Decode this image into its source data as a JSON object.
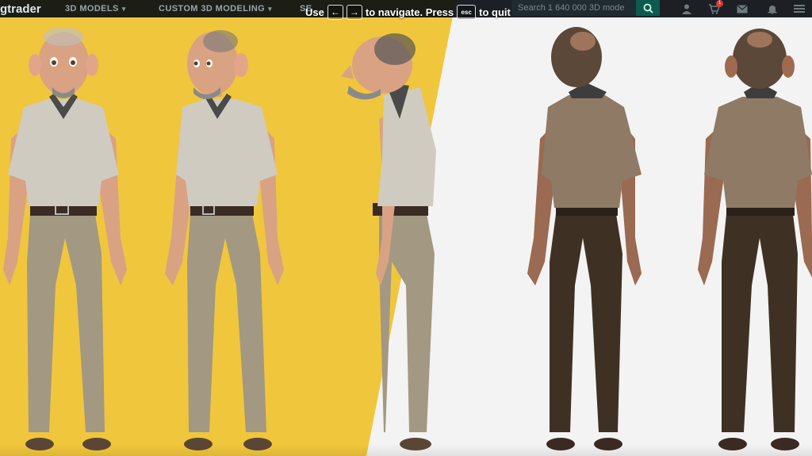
{
  "header": {
    "brand": "gtrader",
    "nav": [
      {
        "label": "3D MODELS"
      },
      {
        "label": "CUSTOM 3D MODELING"
      },
      {
        "label": "SE"
      }
    ],
    "search": {
      "placeholder": "Search 1 640 000 3D mode"
    },
    "cart_badge": "1"
  },
  "hint": {
    "use": "Use",
    "prev_key": "←",
    "next_key": "→",
    "navigate": "to navigate. Press",
    "esc_key": "esc",
    "quit": "to quit"
  },
  "colors": {
    "yellow_backdrop": "#f0c63c",
    "white_backdrop": "#f3f3f3",
    "shirt": "#cfcbc0",
    "pants_light": "#a39882",
    "pants_dark": "#3e3124"
  },
  "icons": [
    "search-icon",
    "person-icon",
    "cart-icon",
    "mail-icon",
    "notification-icon",
    "menu-icon"
  ]
}
